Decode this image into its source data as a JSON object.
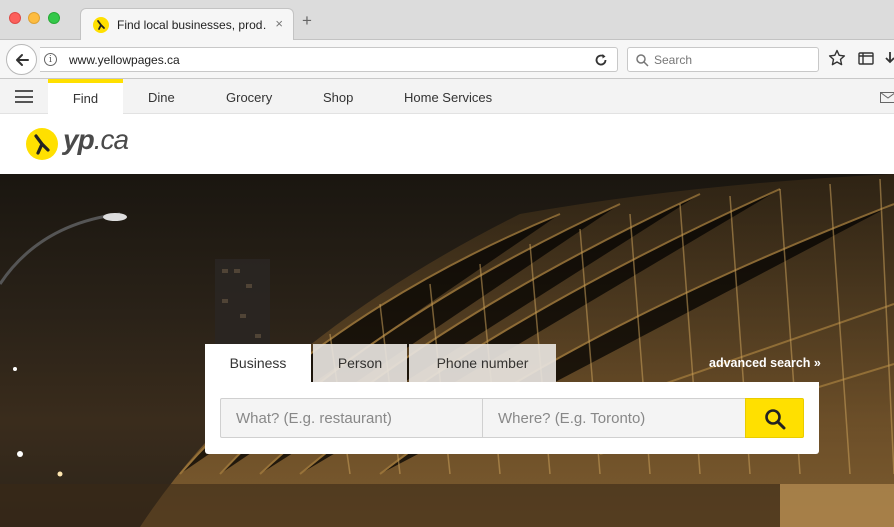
{
  "browser": {
    "tab_title": "Find local businesses, prod…",
    "tab_close": "×",
    "new_tab": "+",
    "url": "www.yellowpages.ca",
    "search_placeholder": "Search"
  },
  "site_nav": {
    "items": [
      {
        "label": "Find"
      },
      {
        "label": "Dine"
      },
      {
        "label": "Grocery"
      },
      {
        "label": "Shop"
      },
      {
        "label": "Home Services"
      }
    ]
  },
  "logo": {
    "brand": "yp",
    "domain": ".ca"
  },
  "search": {
    "tabs": [
      {
        "label": "Business",
        "active": true
      },
      {
        "label": "Person",
        "active": false
      },
      {
        "label": "Phone number",
        "active": false
      }
    ],
    "advanced_label": "advanced search »",
    "what_placeholder": "What? (E.g. restaurant)",
    "where_placeholder": "Where? (E.g. Toronto)"
  },
  "colors": {
    "brand_yellow": "#ffe000",
    "text_dark": "#333333"
  },
  "icons": [
    "back-arrow-icon",
    "info-icon",
    "reload-icon",
    "search-icon",
    "star-icon",
    "library-icon",
    "download-icon",
    "hamburger-icon",
    "mail-icon",
    "yp-logo-icon",
    "magnifier-icon"
  ]
}
